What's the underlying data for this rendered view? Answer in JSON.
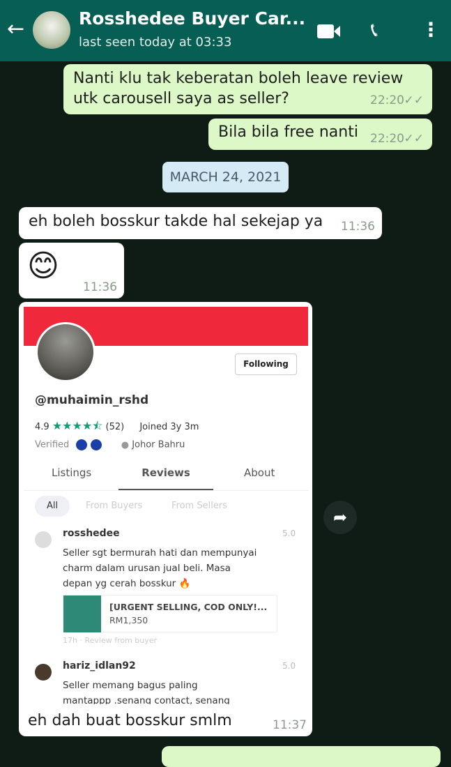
{
  "header": {
    "title": "Rosshedee Buyer Car...",
    "status": "last seen today at 03:33",
    "icons": [
      "back-arrow-icon",
      "video-call-icon",
      "phone-icon",
      "more-vert-icon"
    ]
  },
  "messages": [
    {
      "dir": "out",
      "lines": [
        "Nanti klu tak keberatan boleh leave review",
        "utk carousell saya as seller?"
      ],
      "time": "22:20"
    },
    {
      "dir": "out",
      "text": "Bila bila free nanti",
      "time": "22:20"
    },
    {
      "dir": "in",
      "text": "eh boleh bosskur takde hal sekejap ya",
      "time": "11:36"
    },
    {
      "dir": "in",
      "text": "😊",
      "time": "11:36"
    },
    {
      "dir": "in",
      "caption": "eh dah buat bosskur smlm",
      "time": "11:37"
    }
  ],
  "date_badge": "MARCH 24, 2021",
  "profile": {
    "username": "@muhaimin_rshd",
    "follow_label": "Following",
    "rating": "4.9",
    "stars": 4.5,
    "review_count": "(52)",
    "joined": "Joined 3y 3m",
    "verified": "Verified",
    "location": "Johor Bahru",
    "tabs": [
      "Listings",
      "Reviews",
      "About"
    ],
    "active_tab": "Reviews",
    "filters": [
      "All",
      "From Buyers",
      "From Sellers"
    ],
    "reviews": [
      {
        "user": "rosshedee",
        "score": "5.0",
        "lines": [
          "Seller sgt bermurah hati dan mempunyai",
          "charm dalam urusan jual beli. Masa",
          "depan yg cerah bosskur 🔥"
        ],
        "listing_title": "[URGENT SELLING, COD ONLY!...",
        "listing_price": "RM1,350",
        "meta": "17h · Review from buyer"
      },
      {
        "user": "hariz_idlan92",
        "score": "5.0",
        "lines": [
          "Seller memang bagus paling",
          "mantappp .senang contact, senang"
        ]
      }
    ],
    "accent": "#f0283c",
    "star_color": "#0f9d7a"
  }
}
